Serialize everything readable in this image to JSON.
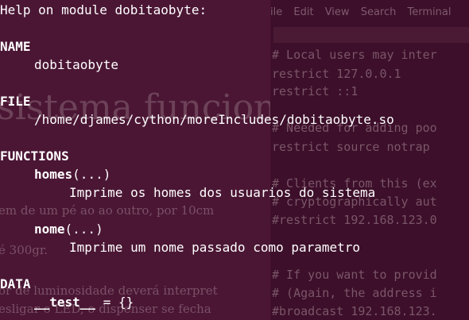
{
  "background_document": {
    "heading_fragment": "sistema funcion",
    "lines": [
      "em de um pé ao ao outro, por 10cm",
      "é 300gr.",
      "or de luminosidade deverá interpret",
      "esligar o LED, o dispenser se fecha"
    ]
  },
  "background_terminal": {
    "menu": [
      "ile",
      "Edit",
      "View",
      "Search",
      "Terminal"
    ],
    "lines": [
      "# Local users may inter",
      "restrict 127.0.0.1",
      "restrict ::1",
      "# Needed for adding poo",
      "restrict source notrap",
      "# Clients from this (ex",
      "# cryptographically aut",
      "#restrict 192.168.123.0",
      "# If you want to provid",
      "# (Again, the address i",
      "#broadcast 192.168.123."
    ]
  },
  "help": {
    "header": "Help on module dobitaobyte:",
    "name_section": "NAME",
    "name_value": "dobitaobyte",
    "file_section": "FILE",
    "file_value": "/home/djames/cython/moreIncludes/dobitaobyte.so",
    "functions_section": "FUNCTIONS",
    "functions": [
      {
        "name": "homes",
        "signature": "(...)",
        "doc": "Imprime os homes dos usuarios do sistema"
      },
      {
        "name": "nome",
        "signature": "(...)",
        "doc": "Imprime um nome passado como parametro"
      }
    ],
    "data_section": "DATA",
    "data_entry_name": "__test__",
    "data_entry_value": " = {}"
  }
}
